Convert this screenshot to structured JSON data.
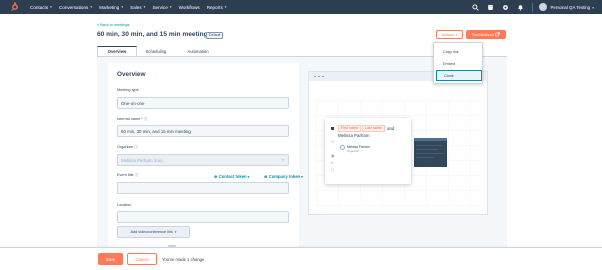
{
  "nav": {
    "items": [
      {
        "label": "Contacts"
      },
      {
        "label": "Conversations"
      },
      {
        "label": "Marketing"
      },
      {
        "label": "Sales"
      },
      {
        "label": "Service"
      },
      {
        "label": "Workflows"
      },
      {
        "label": "Reports"
      }
    ],
    "account_label": "Personal QA Testing",
    "icons": [
      "search-icon",
      "marketplace-icon",
      "settings-icon",
      "notifications-icon"
    ]
  },
  "header": {
    "back_link": "< Back to meetings",
    "title": "60 min, 30 min, and 15 min meeting",
    "badge": "Default",
    "actions_label": "Actions",
    "troubleshoot_label": "Troubleshoot"
  },
  "actions_menu": {
    "items": [
      {
        "label": "Copy link"
      },
      {
        "label": "Embed"
      },
      {
        "label": "Clone",
        "active": true
      }
    ]
  },
  "tabs": [
    {
      "label": "Overview",
      "active": true
    },
    {
      "label": "Scheduling"
    },
    {
      "label": "Automation"
    }
  ],
  "form": {
    "section_title": "Overview",
    "meeting_type": {
      "label": "Meeting type",
      "value": "One-on-one"
    },
    "internal_name": {
      "label": "Internal name *",
      "value": "60 min, 30 min, and 15 min meeting"
    },
    "organizer": {
      "label": "Organizer",
      "value": "Melissa Parham (me)"
    },
    "event_title": {
      "label": "Event title",
      "value": ""
    },
    "contact_token": "Contact token",
    "company_token": "Company token",
    "location": {
      "label": "Location",
      "value": ""
    },
    "add_video_label": "Add videoconference link"
  },
  "preview": {
    "first_name_token": "First name",
    "last_name_token": "Last name",
    "and_text": "and",
    "host_name": "Melissa Parham",
    "guest_name": "Melissa Parham",
    "guest_role": "Organizer"
  },
  "footer": {
    "save_label": "Save",
    "cancel_label": "Cancel",
    "change_text": "You've made 1 change"
  },
  "colors": {
    "nav_bg": "#2d3e50",
    "accent": "#ff7a59",
    "link": "#0091ae",
    "text": "#33475b"
  }
}
